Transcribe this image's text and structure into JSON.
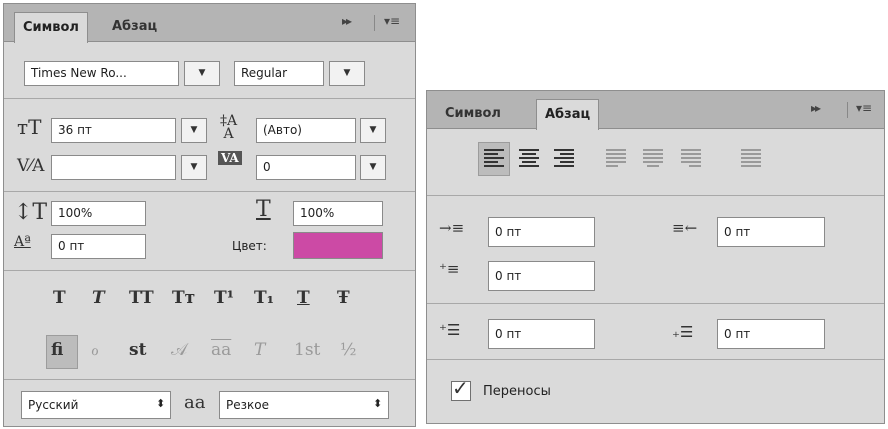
{
  "character_panel": {
    "tabs": {
      "symbol": "Символ",
      "paragraph": "Абзац"
    },
    "toolbar": {
      "collapse": "▸▸",
      "menu": "▾≡"
    },
    "font_family": "Times New Ro...",
    "font_style": "Regular",
    "font_size": "36 пт",
    "leading": "(Авто)",
    "kerning": "",
    "tracking": "0",
    "vertical_scale": "100%",
    "horizontal_scale": "100%",
    "baseline_shift": "0 пт",
    "color_label": "Цвет:",
    "color_value": "#cc4aa5",
    "type_buttons": [
      "T",
      "T",
      "TT",
      "Tт",
      "T¹",
      "T₁",
      "T",
      "Ŧ"
    ],
    "opentype_buttons": [
      "fi",
      "ℴ",
      "st",
      "𝒜",
      "aa",
      "T",
      "1st",
      "½"
    ],
    "language": "Русский",
    "aa_icon": "aa",
    "antialias": "Резкое"
  },
  "paragraph_panel": {
    "tabs": {
      "symbol": "Символ",
      "paragraph": "Абзац"
    },
    "toolbar": {
      "collapse": "▸▸",
      "menu": "▾≡"
    },
    "indent_left": "0 пт",
    "indent_right": "0 пт",
    "indent_first_line": "0 пт",
    "space_before": "0 пт",
    "space_after": "0 пт",
    "hyphenate_label": "Переносы",
    "hyphenate_checked": true
  }
}
